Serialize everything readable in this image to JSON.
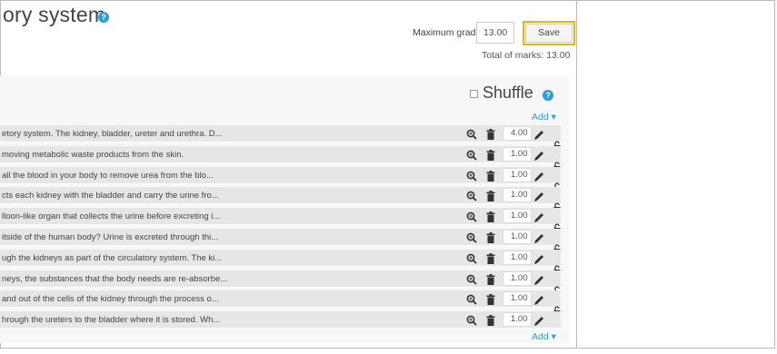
{
  "page": {
    "title": "ory system"
  },
  "toolbar": {
    "max_grade_label": "Maximum grade",
    "max_grade_value": "13.00",
    "save_label": "Save",
    "total_marks": "Total of marks: 13.00"
  },
  "section": {
    "shuffle_label": "Shuffle",
    "shuffle_checked": false,
    "add_label_top": "Add ▾",
    "add_label_bottom": "Add ▾"
  },
  "questions": [
    {
      "text": "etory system. The kidney, bladder, ureter and urethra. D...",
      "mark": "4.00"
    },
    {
      "text": "moving metabolic waste products from the skin.",
      "mark": "1.00"
    },
    {
      "text": "all the blood in your body to remove urea from the blo...",
      "mark": "1.00"
    },
    {
      "text": "cts each kidney with the bladder and carry the urine fro...",
      "mark": "1.00"
    },
    {
      "text": "lloon-like organ that collects the urine before excreting i...",
      "mark": "1.00"
    },
    {
      "text": "itside of the human body? Urine is excreted through thi...",
      "mark": "1.00"
    },
    {
      "text": "ugh the kidneys as part of the circulatory system. The ki...",
      "mark": "1.00"
    },
    {
      "text": "neys, the substances that the body needs are re-absorbe...",
      "mark": "1.00"
    },
    {
      "text": "and out of the cells of the kidney through the process o...",
      "mark": "1.00"
    },
    {
      "text": "hrough the ureters to the bladder where it is stored. Wh...",
      "mark": "1.00"
    }
  ],
  "colors": {
    "accent": "#2a9fd6",
    "highlight": "#e6b800",
    "row_bg": "#e6e6e6"
  },
  "icons": [
    "help-icon",
    "zoom-icon",
    "trash-icon",
    "pencil-icon",
    "lock-icon"
  ]
}
